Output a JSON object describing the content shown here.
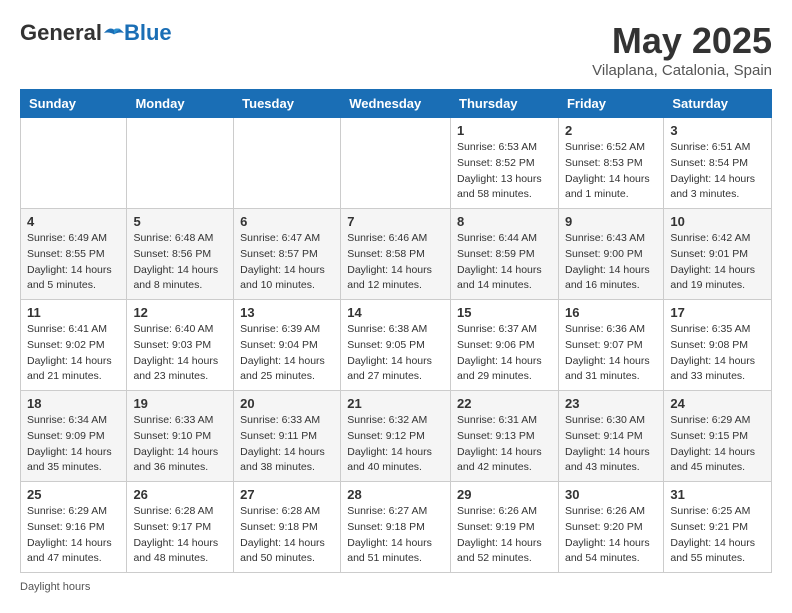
{
  "header": {
    "logo_general": "General",
    "logo_blue": "Blue",
    "month_title": "May 2025",
    "location": "Vilaplana, Catalonia, Spain"
  },
  "days_of_week": [
    "Sunday",
    "Monday",
    "Tuesday",
    "Wednesday",
    "Thursday",
    "Friday",
    "Saturday"
  ],
  "weeks": [
    [
      {
        "day": "",
        "info": ""
      },
      {
        "day": "",
        "info": ""
      },
      {
        "day": "",
        "info": ""
      },
      {
        "day": "",
        "info": ""
      },
      {
        "day": "1",
        "info": "Sunrise: 6:53 AM\nSunset: 8:52 PM\nDaylight: 13 hours and 58 minutes."
      },
      {
        "day": "2",
        "info": "Sunrise: 6:52 AM\nSunset: 8:53 PM\nDaylight: 14 hours and 1 minute."
      },
      {
        "day": "3",
        "info": "Sunrise: 6:51 AM\nSunset: 8:54 PM\nDaylight: 14 hours and 3 minutes."
      }
    ],
    [
      {
        "day": "4",
        "info": "Sunrise: 6:49 AM\nSunset: 8:55 PM\nDaylight: 14 hours and 5 minutes."
      },
      {
        "day": "5",
        "info": "Sunrise: 6:48 AM\nSunset: 8:56 PM\nDaylight: 14 hours and 8 minutes."
      },
      {
        "day": "6",
        "info": "Sunrise: 6:47 AM\nSunset: 8:57 PM\nDaylight: 14 hours and 10 minutes."
      },
      {
        "day": "7",
        "info": "Sunrise: 6:46 AM\nSunset: 8:58 PM\nDaylight: 14 hours and 12 minutes."
      },
      {
        "day": "8",
        "info": "Sunrise: 6:44 AM\nSunset: 8:59 PM\nDaylight: 14 hours and 14 minutes."
      },
      {
        "day": "9",
        "info": "Sunrise: 6:43 AM\nSunset: 9:00 PM\nDaylight: 14 hours and 16 minutes."
      },
      {
        "day": "10",
        "info": "Sunrise: 6:42 AM\nSunset: 9:01 PM\nDaylight: 14 hours and 19 minutes."
      }
    ],
    [
      {
        "day": "11",
        "info": "Sunrise: 6:41 AM\nSunset: 9:02 PM\nDaylight: 14 hours and 21 minutes."
      },
      {
        "day": "12",
        "info": "Sunrise: 6:40 AM\nSunset: 9:03 PM\nDaylight: 14 hours and 23 minutes."
      },
      {
        "day": "13",
        "info": "Sunrise: 6:39 AM\nSunset: 9:04 PM\nDaylight: 14 hours and 25 minutes."
      },
      {
        "day": "14",
        "info": "Sunrise: 6:38 AM\nSunset: 9:05 PM\nDaylight: 14 hours and 27 minutes."
      },
      {
        "day": "15",
        "info": "Sunrise: 6:37 AM\nSunset: 9:06 PM\nDaylight: 14 hours and 29 minutes."
      },
      {
        "day": "16",
        "info": "Sunrise: 6:36 AM\nSunset: 9:07 PM\nDaylight: 14 hours and 31 minutes."
      },
      {
        "day": "17",
        "info": "Sunrise: 6:35 AM\nSunset: 9:08 PM\nDaylight: 14 hours and 33 minutes."
      }
    ],
    [
      {
        "day": "18",
        "info": "Sunrise: 6:34 AM\nSunset: 9:09 PM\nDaylight: 14 hours and 35 minutes."
      },
      {
        "day": "19",
        "info": "Sunrise: 6:33 AM\nSunset: 9:10 PM\nDaylight: 14 hours and 36 minutes."
      },
      {
        "day": "20",
        "info": "Sunrise: 6:33 AM\nSunset: 9:11 PM\nDaylight: 14 hours and 38 minutes."
      },
      {
        "day": "21",
        "info": "Sunrise: 6:32 AM\nSunset: 9:12 PM\nDaylight: 14 hours and 40 minutes."
      },
      {
        "day": "22",
        "info": "Sunrise: 6:31 AM\nSunset: 9:13 PM\nDaylight: 14 hours and 42 minutes."
      },
      {
        "day": "23",
        "info": "Sunrise: 6:30 AM\nSunset: 9:14 PM\nDaylight: 14 hours and 43 minutes."
      },
      {
        "day": "24",
        "info": "Sunrise: 6:29 AM\nSunset: 9:15 PM\nDaylight: 14 hours and 45 minutes."
      }
    ],
    [
      {
        "day": "25",
        "info": "Sunrise: 6:29 AM\nSunset: 9:16 PM\nDaylight: 14 hours and 47 minutes."
      },
      {
        "day": "26",
        "info": "Sunrise: 6:28 AM\nSunset: 9:17 PM\nDaylight: 14 hours and 48 minutes."
      },
      {
        "day": "27",
        "info": "Sunrise: 6:28 AM\nSunset: 9:18 PM\nDaylight: 14 hours and 50 minutes."
      },
      {
        "day": "28",
        "info": "Sunrise: 6:27 AM\nSunset: 9:18 PM\nDaylight: 14 hours and 51 minutes."
      },
      {
        "day": "29",
        "info": "Sunrise: 6:26 AM\nSunset: 9:19 PM\nDaylight: 14 hours and 52 minutes."
      },
      {
        "day": "30",
        "info": "Sunrise: 6:26 AM\nSunset: 9:20 PM\nDaylight: 14 hours and 54 minutes."
      },
      {
        "day": "31",
        "info": "Sunrise: 6:25 AM\nSunset: 9:21 PM\nDaylight: 14 hours and 55 minutes."
      }
    ]
  ],
  "footer": {
    "text": "Daylight hours"
  }
}
